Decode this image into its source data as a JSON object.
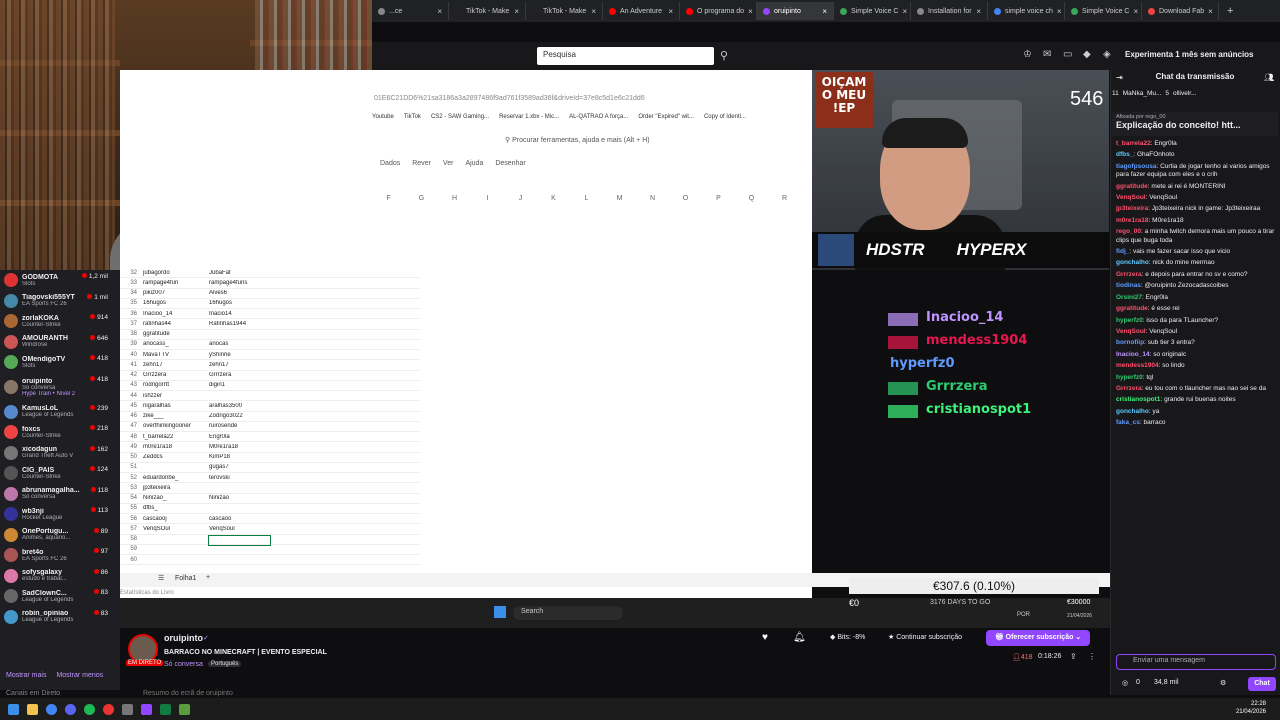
{
  "browser": {
    "tabs": [
      {
        "label": "...ce",
        "active": false,
        "color": "#888"
      },
      {
        "label": "TikTok - Make",
        "active": false,
        "color": "#222"
      },
      {
        "label": "TikTok - Make",
        "active": false,
        "color": "#222"
      },
      {
        "label": "An Adventure",
        "active": false,
        "color": "#ff0000"
      },
      {
        "label": "O programa do",
        "active": false,
        "color": "#ff0000"
      },
      {
        "label": "oruipinto",
        "active": true,
        "color": "#9147ff"
      },
      {
        "label": "Simple Voice C",
        "active": false,
        "color": "#3ba55c"
      },
      {
        "label": "Installation for",
        "active": false,
        "color": "#888"
      },
      {
        "label": "simple voice ch",
        "active": false,
        "color": "#4285f4"
      },
      {
        "label": "Simple Voice C",
        "active": false,
        "color": "#3ba55c"
      },
      {
        "label": "Download Fab",
        "active": false,
        "color": "#e44"
      }
    ],
    "new_tab": "+"
  },
  "twitch_top": {
    "search_placeholder": "Pesquisa",
    "promo": "Experimenta 1 mês sem anúncios"
  },
  "sheet": {
    "url": "01E6C21DD6%21sa3186a3a2897486f9ad761f3589ad36f&driveId=37e8c5d1e6c21dd6",
    "bookmarks": [
      "Youtube",
      "TikTok",
      "CS2 - SAW Gaming...",
      "Reservar 1.xbx - Mic...",
      "AL-QATRAO A força...",
      "Order \"Expired\" wit...",
      "Copy of Identi..."
    ],
    "tool_search": "Procurar ferramentas, ajuda e mais (Alt + H)",
    "menus": [
      "Dados",
      "Rever",
      "Ver",
      "Ajuda",
      "Desenhar"
    ],
    "columns": [
      "F",
      "G",
      "H",
      "I",
      "J",
      "K",
      "L",
      "M",
      "N",
      "O",
      "P",
      "Q",
      "R"
    ],
    "rows": [
      [
        "32",
        "jubagordo",
        "JubaFat"
      ],
      [
        "33",
        "rampage4fun",
        "rampage4funs"
      ],
      [
        "34",
        "pikiz007",
        "Alves6"
      ],
      [
        "35",
        "16hugos",
        "16hugos"
      ],
      [
        "36",
        "Inacioo_14",
        "Inacio14"
      ],
      [
        "37",
        "rafinhas44",
        "Rafinhas1944"
      ],
      [
        "38",
        "ggratitude",
        ""
      ],
      [
        "39",
        "anocass_",
        "anocas"
      ],
      [
        "40",
        "MavaTTV",
        "yShinne"
      ],
      [
        "41",
        "zehn17",
        "zehn17"
      ],
      [
        "42",
        "Grrzzera",
        "Grrrzera"
      ],
      [
        "43",
        "rodrigorrtt",
        "digin1"
      ],
      [
        "44",
        "ishzzer",
        ""
      ],
      [
        "45",
        "nigaralhas",
        "aralhas3500"
      ],
      [
        "46",
        "zike___",
        "Zodrigo3022"
      ],
      [
        "47",
        "overthinkingooner",
        "ruirosende"
      ],
      [
        "48",
        "t_barrela22",
        "Engr0la"
      ],
      [
        "49",
        "m0re1ra18",
        "M0re1ra18"
      ],
      [
        "50",
        "Zeddcs",
        "KimP18"
      ],
      [
        "51",
        "",
        "gugas7"
      ],
      [
        "52",
        "eduardoribe_",
        "terovski"
      ],
      [
        "53",
        "jp3teixeira",
        ""
      ],
      [
        "54",
        "Ninizao_",
        "Ninizao"
      ],
      [
        "55",
        "dfbs_",
        ""
      ],
      [
        "56",
        "cascaooj",
        "cascaoo"
      ],
      [
        "57",
        "VenqSOul",
        "VenqSoul"
      ],
      [
        "58",
        "",
        ""
      ],
      [
        "59",
        "",
        ""
      ],
      [
        "60",
        "",
        ""
      ]
    ],
    "sheet_tab": "Folha1",
    "status": "Estatísticas do Livro"
  },
  "cam2": {
    "oicam": "OIÇAM O MEU !EP",
    "viewers": "546",
    "sponsor1": "HDSTR",
    "sponsor2": "HYPERX"
  },
  "overlay_chat": [
    {
      "user": "Inacioo_14",
      "color": "#bf94ff"
    },
    {
      "user": "mendess1904",
      "color": "#e8174f"
    },
    {
      "user": "hyperfz0",
      "color": "#5f9bff"
    },
    {
      "user": "Grrrzera",
      "color": "#2ecc71"
    },
    {
      "user": "cristianospot1",
      "color": "#3df27a"
    }
  ],
  "balance": "€307.6 (0.10%)",
  "inner_taskbar": {
    "search": "Search",
    "info": "3176 DAYS TO GO",
    "lang": "POR",
    "prize": "€30000",
    "date": "21/04/2026",
    "left_val": "€0"
  },
  "sidebar": [
    {
      "name": "GODMOTA",
      "game": "Slots",
      "viewers": "1,2 mil",
      "color": "#d33"
    },
    {
      "name": "Tiagovski555YT",
      "game": "EA Sports FC 26",
      "viewers": "1 mil",
      "color": "#48a"
    },
    {
      "name": "zorlaKOKA",
      "game": "Counter-Strike",
      "viewers": "914",
      "color": "#a63"
    },
    {
      "name": "AMOURANTH",
      "game": "Windrose",
      "viewers": "646",
      "color": "#c55"
    },
    {
      "name": "OMendigoTV",
      "game": "Slots",
      "viewers": "418",
      "color": "#5a5"
    },
    {
      "name": "oruipinto",
      "game": "Só conversa",
      "viewers": "418",
      "color": "#876"
    },
    {
      "name": "KamusLoL",
      "game": "League of Legends",
      "viewers": "239",
      "color": "#58c"
    },
    {
      "name": "foxcs",
      "game": "Counter-Strike",
      "viewers": "218",
      "color": "#e44"
    },
    {
      "name": "xicodagun",
      "game": "Grand Theft Auto V",
      "viewers": "162",
      "color": "#777"
    },
    {
      "name": "CIG_PAIS",
      "game": "Counter-Strike",
      "viewers": "124",
      "color": "#555"
    },
    {
      "name": "abrunamagalha...",
      "game": "Só conversa",
      "viewers": "118",
      "color": "#b7a"
    },
    {
      "name": "wb3nji",
      "game": "Rocket League",
      "viewers": "113",
      "color": "#339"
    },
    {
      "name": "OnePortugu...",
      "game": "Animes, aquário...",
      "viewers": "89",
      "color": "#c83"
    },
    {
      "name": "bret4o",
      "game": "EA Sports FC 26",
      "viewers": "97",
      "color": "#a55"
    },
    {
      "name": "sofysgalaxy",
      "game": "estudo e trabal...",
      "viewers": "86",
      "color": "#d7a"
    },
    {
      "name": "SadClownC...",
      "game": "League of Legends",
      "viewers": "83",
      "color": "#666"
    },
    {
      "name": "robin_opiniao",
      "game": "League of Legends",
      "viewers": "83",
      "color": "#49c"
    }
  ],
  "sidebar_hype": "Hype Train • Nível 2",
  "sidebar_more": [
    "Mostrar mais",
    "Mostrar menos"
  ],
  "sidebar_footer": "Canais em Direto",
  "stream": {
    "name": "oruipinto",
    "title": "BARRACO NO MINECRAFT | EVENTO ESPECIAL",
    "category": "Só conversa",
    "lang": "Português",
    "live": "EM DIRETO",
    "bits": "Bits: -8%",
    "cont_sub": "Continuar subscrição",
    "offer_sub": "Oferecer subscrição",
    "viewers": "418",
    "uptime": "0:18:26",
    "summary": "Resumo do ecrã de oruipinto"
  },
  "chat": {
    "header": "Chat da transmissão",
    "leaders": [
      "11",
      "MaNka_Mu...",
      "5",
      "ollivelr..."
    ],
    "pinned_by": "Afixada por rego_00",
    "pinned": "Explicação do conceito! htt...",
    "messages": [
      {
        "u": "t_barrela22",
        "c": "#ff4f6d",
        "t": "Engr0la"
      },
      {
        "u": "dfbs_",
        "c": "#5fc9ff",
        "t": "GhaFOnhoto"
      },
      {
        "u": "tiagofpsousa",
        "c": "#5f9bff",
        "t": "Curtia de jogar tenho ai varios amigos para fazer equipa com eles e o crih"
      },
      {
        "u": "ggratitude",
        "c": "#ff4f6d",
        "t": "mete ai rei é MONTERINI"
      },
      {
        "u": "VenqSoul",
        "c": "#ff4f6d",
        "t": "VenqSoul"
      },
      {
        "u": "jp3teixeira",
        "c": "#ff4f6d",
        "t": "Jp3teixeira nick in game: Jp3teixeiraa"
      },
      {
        "u": "m0re1ra18",
        "c": "#ff4f6d",
        "t": "M0re1ra18"
      },
      {
        "u": "rego_00",
        "c": "#ff4f6d",
        "t": "a minha twitch demora mais um pouco a tirar clips que buga toda"
      },
      {
        "u": "fidj_",
        "c": "#5f9bff",
        "t": "vais me fazer sacar isso que vicio"
      },
      {
        "u": "gonchalho",
        "c": "#5fc9ff",
        "t": "nick do mine mermao"
      },
      {
        "u": "Grrrzera",
        "c": "#ff4f6d",
        "t": "e depois para entrar no sv e como?"
      },
      {
        "u": "tiodinas",
        "c": "#5f9bff",
        "t": "@oruipinto Zezocadascoibes"
      },
      {
        "u": "Orsini27",
        "c": "#2ecc71",
        "t": "Engr0la"
      },
      {
        "u": "ggratitude",
        "c": "#ff4f6d",
        "t": "é esse rei"
      },
      {
        "u": "hyperfz0",
        "c": "#2ecc71",
        "t": "isso da para TLauncher?"
      },
      {
        "u": "VenqSoul",
        "c": "#ff4f6d",
        "t": "VenqSoul"
      },
      {
        "u": "bornofiip",
        "c": "#5f9bff",
        "t": "sub tier 3 entra?"
      },
      {
        "u": "Inacioo_14",
        "c": "#bf94ff",
        "t": "so originalc"
      },
      {
        "u": "mendess1904",
        "c": "#ff4f6d",
        "t": "so lindo"
      },
      {
        "u": "hyperfz0",
        "c": "#2ecc71",
        "t": "tql"
      },
      {
        "u": "Grrrzera",
        "c": "#ff4f6d",
        "t": "eu tou com o tlauncher mas nao sei se da"
      },
      {
        "u": "cristianospot1",
        "c": "#3df27a",
        "t": "grande rui buenas noites"
      },
      {
        "u": "gonchalho",
        "c": "#5fc9ff",
        "t": "ya"
      },
      {
        "u": "faka_cs",
        "c": "#5f9bff",
        "t": "barraco"
      }
    ],
    "input_placeholder": "Enviar uma mensagem",
    "points": "34,8 mil",
    "zero": "0",
    "send": "Chat"
  },
  "clock": {
    "time": "22:28",
    "date": "21/04/2026"
  }
}
